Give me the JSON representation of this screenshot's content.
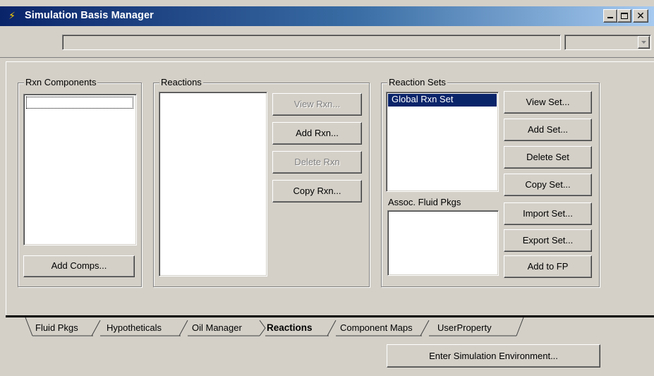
{
  "window": {
    "title": "Simulation Basis Manager",
    "icon": "hysys-app-icon",
    "minimize_label": "_",
    "maximize_label": "□",
    "close_label": "x"
  },
  "toolbar": {
    "path_value": "",
    "dropdown_value": ""
  },
  "rxn_components": {
    "title": "Rxn Components",
    "items": [
      ""
    ],
    "add_button": "Add Comps..."
  },
  "reactions": {
    "title": "Reactions",
    "items": [],
    "buttons": {
      "view": "View Rxn...",
      "add": "Add Rxn...",
      "delete": "Delete Rxn",
      "copy": "Copy Rxn..."
    }
  },
  "reaction_sets": {
    "title": "Reaction Sets",
    "items": [
      "Global Rxn Set"
    ],
    "assoc_label": "Assoc. Fluid Pkgs",
    "assoc_items": [],
    "buttons": {
      "view": "View Set...",
      "add": "Add Set...",
      "delete": "Delete Set",
      "copy": "Copy Set...",
      "import": "Import Set...",
      "export": "Export Set...",
      "add_to_fp": "Add to FP"
    }
  },
  "tabs": [
    {
      "label": "Fluid Pkgs",
      "active": false
    },
    {
      "label": "Hypotheticals",
      "active": false
    },
    {
      "label": "Oil Manager",
      "active": false
    },
    {
      "label": "Reactions",
      "active": true
    },
    {
      "label": "Component Maps",
      "active": false
    },
    {
      "label": "UserProperty",
      "active": false
    }
  ],
  "footer": {
    "enter_button": "Enter Simulation Environment..."
  }
}
